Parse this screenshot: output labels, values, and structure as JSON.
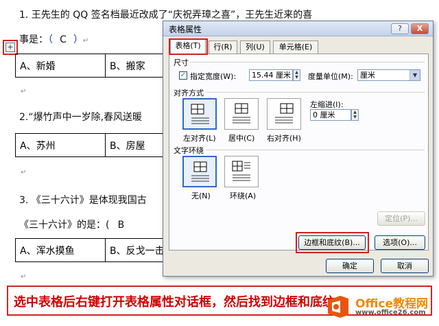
{
  "document": {
    "q1_line1": "1. 王先生的 QQ 签名档最近改成了“庆祝弄璋之喜”，王先生近来的喜",
    "q1_line2_prefix": "事是：",
    "q1_answer": "C",
    "q1_options": [
      "A、新婚",
      "B、搬家"
    ],
    "q2_line1": "2.“爆竹声中一岁除,春风送暖",
    "q2_options": [
      "A、苏州",
      "B、房屋"
    ],
    "q3_line1": "3. 《三十六计》是体现我国古",
    "q3_line2_prefix": "《三十六计》的是：(",
    "q3_answer": "B",
    "q3_options": [
      "A、浑水摸鱼",
      "B、反戈一击"
    ],
    "return_mark": "↵",
    "table_handle": "+"
  },
  "dialog": {
    "title": "表格属性",
    "help_label": "?",
    "close_label": "X",
    "tabs": [
      {
        "label": "表格(T)",
        "active": true
      },
      {
        "label": "行(R)",
        "active": false
      },
      {
        "label": "列(U)",
        "active": false
      },
      {
        "label": "单元格(E)",
        "active": false
      }
    ],
    "size": {
      "section_label": "尺寸",
      "checkbox_label": "指定宽度(W):",
      "checked": true,
      "width_value": "15.44 厘米",
      "unit_label": "度量单位(M):",
      "unit_value": "厘米"
    },
    "alignment": {
      "section_label": "对齐方式",
      "options": [
        "左对齐(L)",
        "居中(C)",
        "右对齐(H)"
      ],
      "selected": 0,
      "indent_label": "左缩进(I):",
      "indent_value": "0 厘米"
    },
    "wrapping": {
      "section_label": "文字环绕",
      "options": [
        "无(N)",
        "环绕(A)"
      ],
      "selected": 0
    },
    "position_button": "定位(P)...",
    "borders_button": "边框和底纹(B)...",
    "options_button": "选项(O)...",
    "ok_button": "确定",
    "cancel_button": "取消"
  },
  "caption": {
    "text": "选中表格后右键打开表格属性对话框，然后找到边框和底纹"
  },
  "watermark": {
    "brand": "Office教程网",
    "url": "www.office26.com"
  },
  "colors": {
    "highlight_red": "#d62020",
    "caption_red": "#d00000",
    "watermark_orange": "#f08a00",
    "selection_blue": "#3169c6"
  }
}
